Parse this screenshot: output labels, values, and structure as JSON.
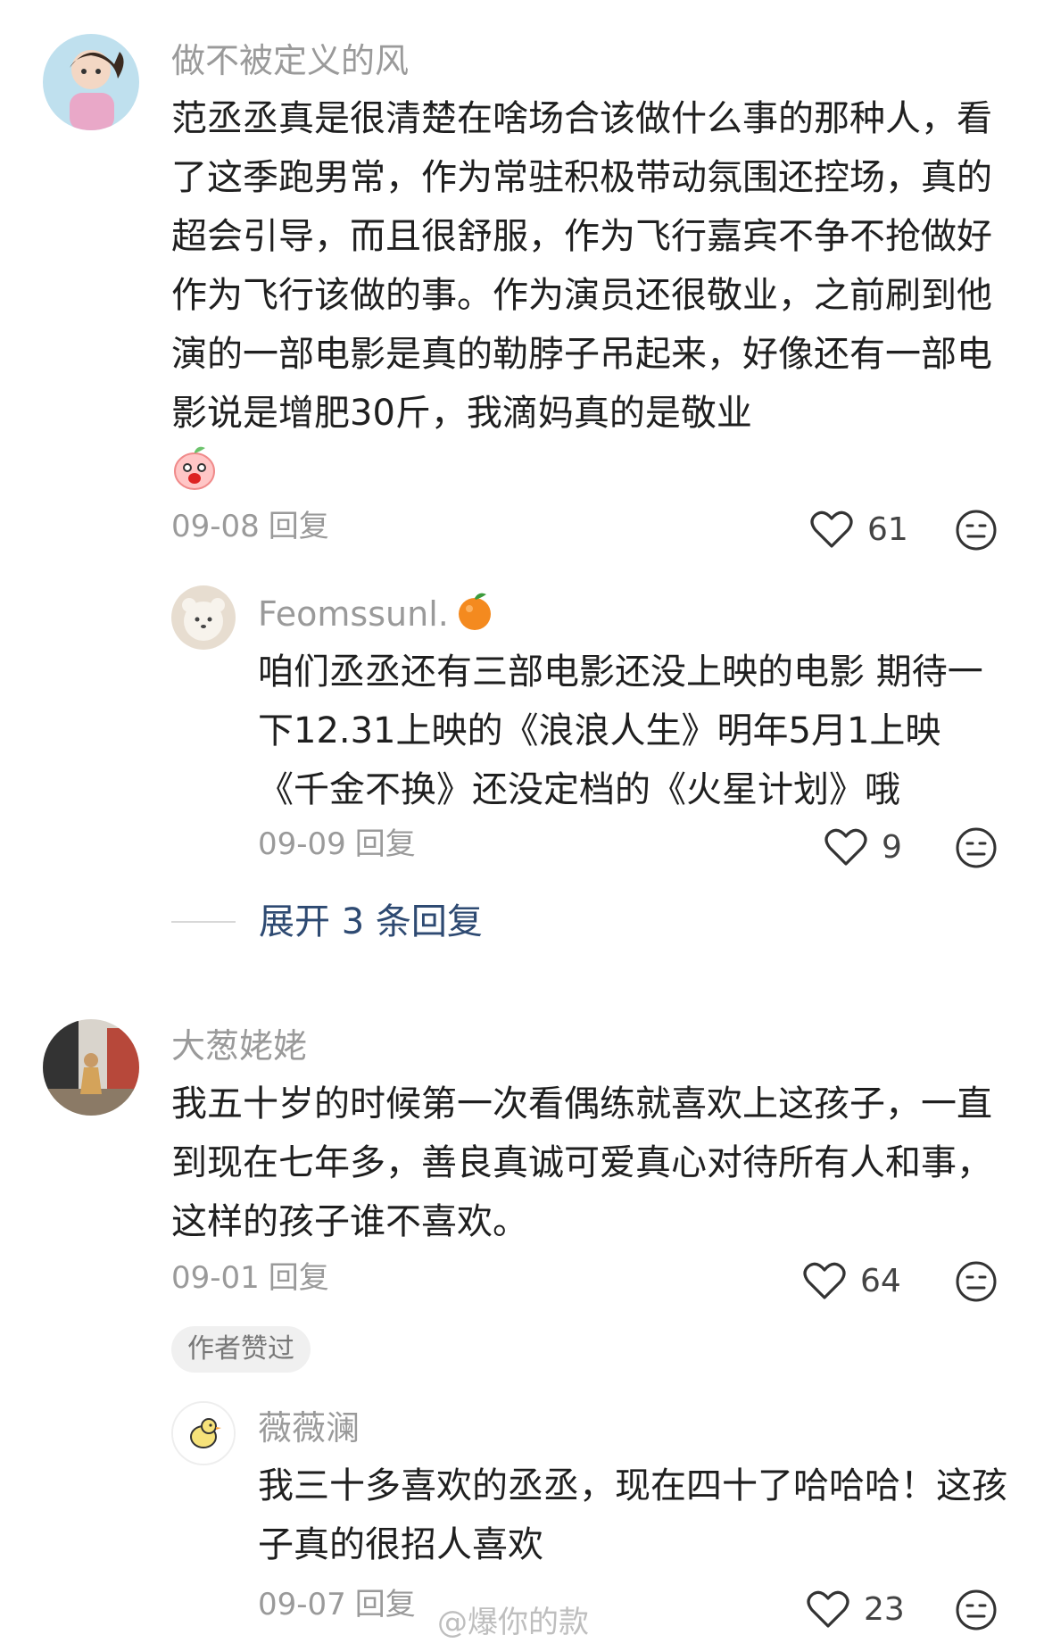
{
  "comments": [
    {
      "username": "做不被定义的风",
      "text": "范丞丞真是很清楚在啥场合该做什么事的那种人，看了这季跑男常，作为常驻积极带动氛围还控场，真的超会引导，而且很舒服，作为飞行嘉宾不争不抢做好作为飞行该做的事。作为演员还很敬业，之前刷到他演的一部电影是真的勒脖子吊起来，好像还有一部电影说是增肥30斤，我滴妈真的是敬业",
      "date": "09-08",
      "reply_label": "回复",
      "likes": "61",
      "replies": [
        {
          "username": "Feomssunl.",
          "text": "咱们丞丞还有三部电影还没上映的电影 期待一下12.31上映的《浪浪人生》明年5月1上映《千金不换》还没定档的《火星计划》哦",
          "date": "09-09",
          "reply_label": "回复",
          "likes": "9"
        }
      ],
      "expand_label": "展开 3 条回复"
    },
    {
      "username": "大葱姥姥",
      "text": "我五十岁的时候第一次看偶练就喜欢上这孩子，一直到现在七年多，善良真诚可爱真心对待所有人和事，这样的孩子谁不喜欢。",
      "date": "09-01",
      "reply_label": "回复",
      "likes": "64",
      "badge": "作者赞过",
      "replies": [
        {
          "username": "薇薇澜",
          "text": "我三十多喜欢的丞丞，现在四十了哈哈哈！这孩子真的很招人喜欢",
          "date": "09-07",
          "reply_label": "回复",
          "likes": "23"
        }
      ]
    }
  ],
  "watermark": "@爆你的款",
  "colors": {
    "expand_link": "#2e4a72",
    "secondary_text": "#9a9a9a"
  }
}
